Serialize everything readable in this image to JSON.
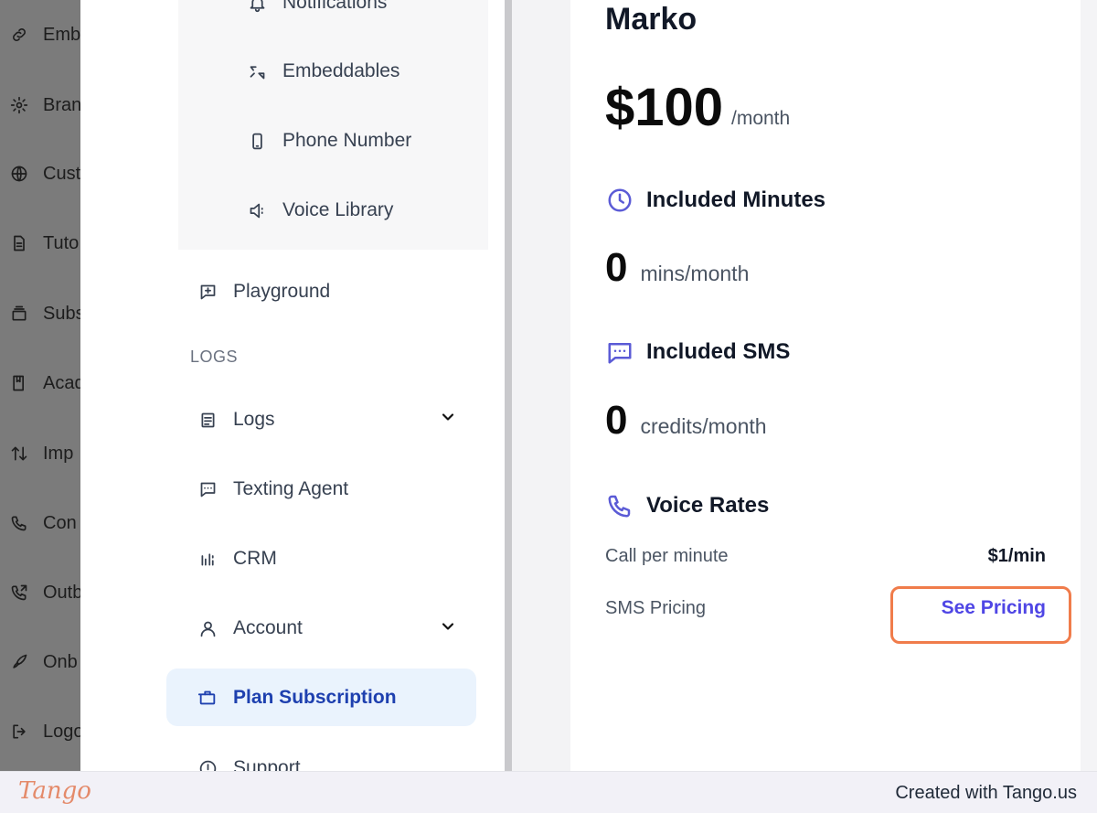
{
  "dim_sidebar": {
    "items": [
      {
        "label": "Emb",
        "icon": "link-icon"
      },
      {
        "label": "Bran",
        "icon": "gear-icon"
      },
      {
        "label": "Cust",
        "icon": "globe-icon"
      },
      {
        "label": "Tuto",
        "icon": "document-icon"
      },
      {
        "label": "Subs",
        "icon": "subscription-icon"
      },
      {
        "label": "Acad",
        "icon": "book-icon"
      },
      {
        "label": "Imp",
        "icon": "import-arrows-icon"
      },
      {
        "label": "Con",
        "icon": "phone-icon"
      },
      {
        "label": "Outb",
        "icon": "outbound-call-icon"
      },
      {
        "label": "Onb",
        "icon": "rocket-icon"
      },
      {
        "label": "Logo",
        "icon": "logout-icon"
      }
    ]
  },
  "nav": {
    "sub_items": [
      {
        "label": "Notifications",
        "icon": "bell-icon"
      },
      {
        "label": "Embeddables",
        "icon": "embed-icon"
      },
      {
        "label": "Phone Number",
        "icon": "mobile-phone-icon"
      },
      {
        "label": "Voice Library",
        "icon": "speaker-icon"
      }
    ],
    "playground": "Playground",
    "section_logs": "LOGS",
    "logs": "Logs",
    "texting_agent": "Texting Agent",
    "crm": "CRM",
    "account": "Account",
    "plan_subscription": "Plan Subscription",
    "support": "Support"
  },
  "plan": {
    "name": "Marko",
    "price": "$100",
    "period": "/month",
    "minutes": {
      "title": "Included Minutes",
      "value": "0",
      "unit": "mins/month"
    },
    "sms": {
      "title": "Included SMS",
      "value": "0",
      "unit": "credits/month"
    },
    "voice_rates": {
      "title": "Voice Rates",
      "call_per_minute_label": "Call per minute",
      "call_per_minute_value": "$1/min",
      "sms_pricing_label": "SMS Pricing",
      "see_pricing": "See Pricing"
    }
  },
  "footer": {
    "logo": "Tango",
    "credit": "Created with Tango.us"
  },
  "colors": {
    "accent": "#5b5bd6",
    "active_nav_bg": "#eaf3fd",
    "active_nav_text": "#1e40af",
    "highlight_box": "#f07c4b"
  }
}
